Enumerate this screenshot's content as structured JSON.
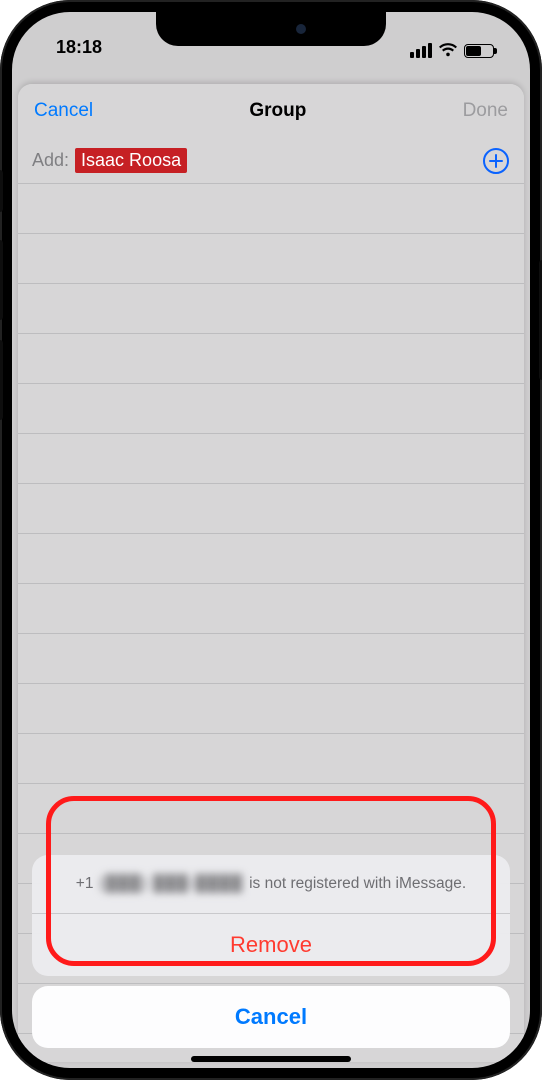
{
  "statusbar": {
    "time": "18:18"
  },
  "nav": {
    "cancel": "Cancel",
    "title": "Group",
    "done": "Done"
  },
  "add": {
    "label": "Add:",
    "contact_name": "Isaac Roosa"
  },
  "sheet": {
    "prefix": "+1",
    "redacted": "(███) ███-████",
    "suffix": "is not registered with iMessage.",
    "remove": "Remove",
    "cancel": "Cancel"
  }
}
